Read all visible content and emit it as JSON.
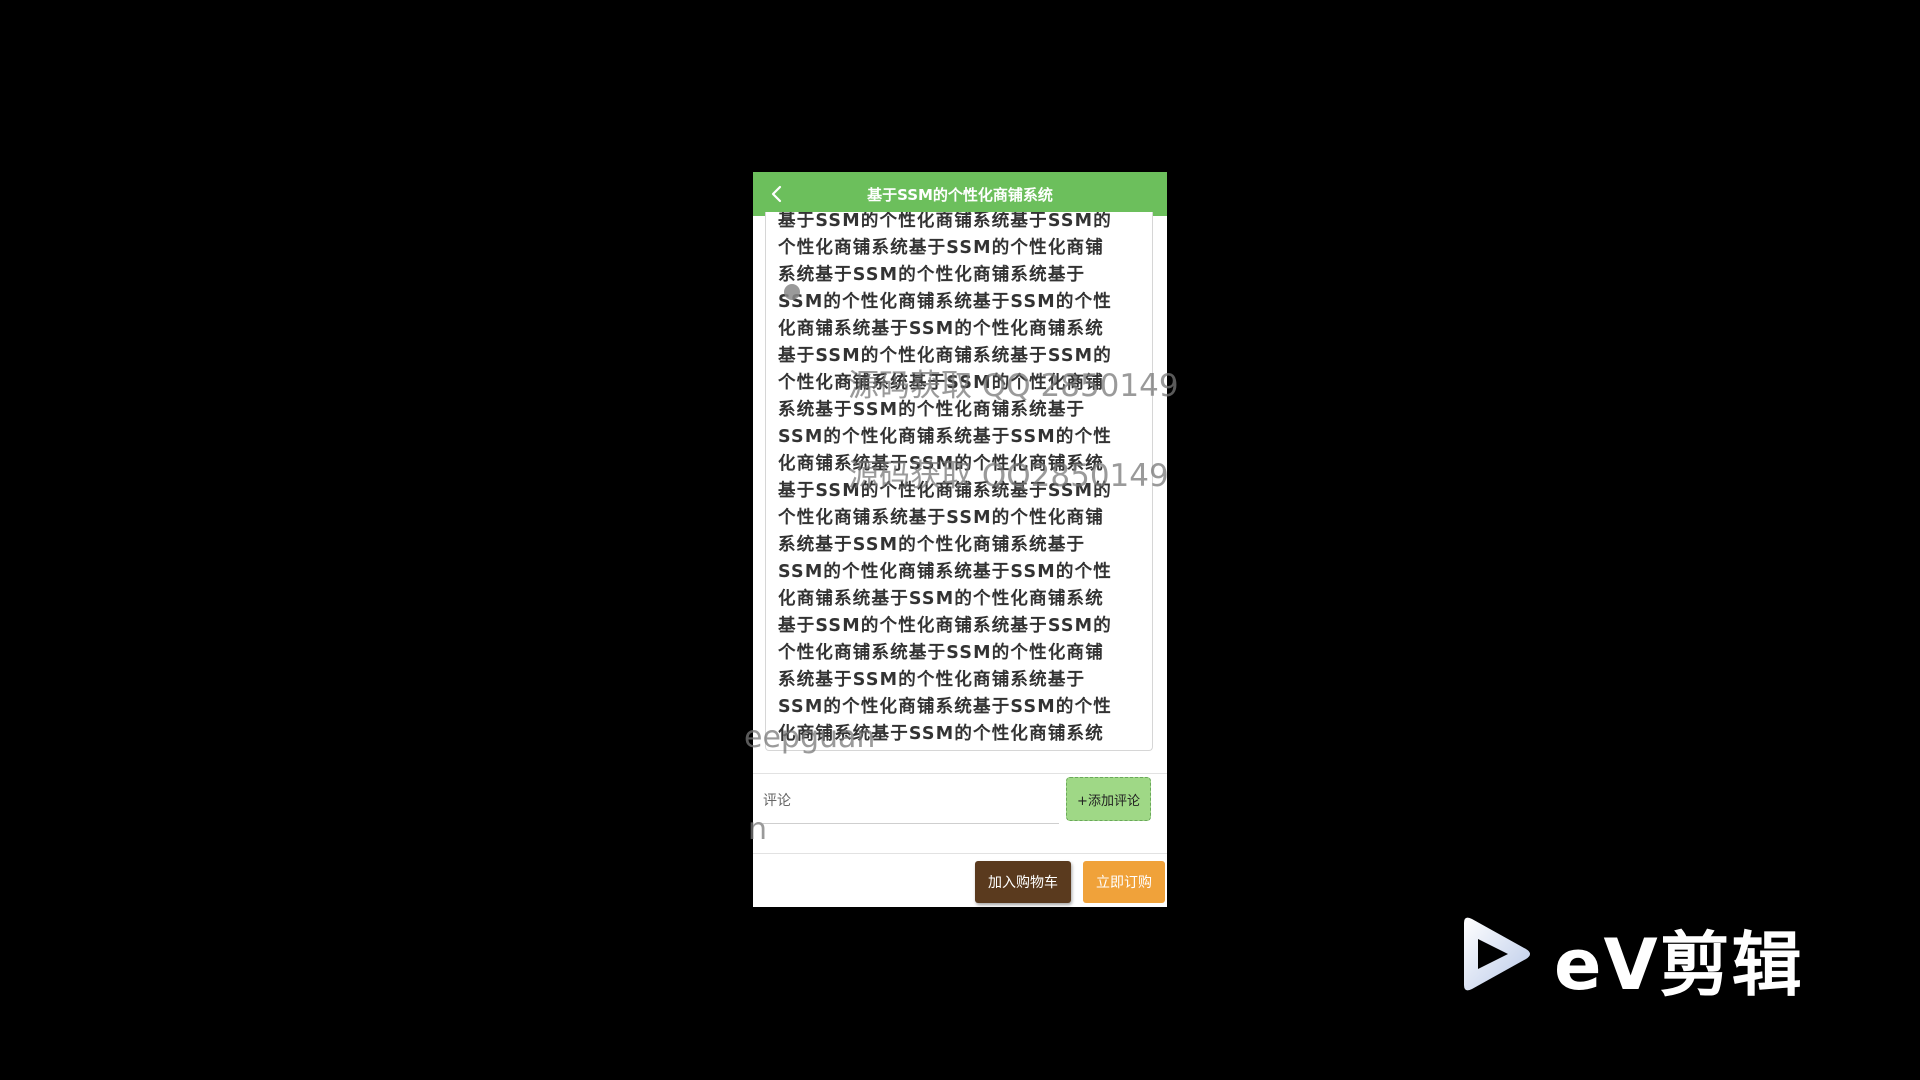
{
  "app": {
    "title": "基于SSM的个性化商铺系统",
    "back_icon": "chevron-left-icon"
  },
  "detail": {
    "text": "基于SSM的个性化商铺系统基于SSM的\n个性化商铺系统基于SSM的个性化商铺\n系统基于SSM的个性化商铺系统基于\nSSM的个性化商铺系统基于SSM的个性\n化商铺系统基于SSM的个性化商铺系统\n基于SSM的个性化商铺系统基于SSM的\n个性化商铺系统基于SSM的个性化商铺\n系统基于SSM的个性化商铺系统基于\nSSM的个性化商铺系统基于SSM的个性\n化商铺系统基于SSM的个性化商铺系统\n基于SSM的个性化商铺系统基于SSM的\n个性化商铺系统基于SSM的个性化商铺\n系统基于SSM的个性化商铺系统基于\nSSM的个性化商铺系统基于SSM的个性\n化商铺系统基于SSM的个性化商铺系统\n基于SSM的个性化商铺系统基于SSM的\n个性化商铺系统基于SSM的个性化商铺\n系统基于SSM的个性化商铺系统基于\nSSM的个性化商铺系统基于SSM的个性\n化商铺系统基于SSM的个性化商铺系统"
  },
  "comment": {
    "placeholder": "评论",
    "add_button": "+添加评论"
  },
  "actions": {
    "add_to_cart": "加入购物车",
    "buy_now": "立即订购"
  },
  "watermarks": {
    "line1": "源码获取 QQ 2850149",
    "line2": "源码获取 QQ2850149",
    "line3": "eepguan",
    "line4": "n"
  },
  "logo": {
    "text": "eV剪辑",
    "icon": "play-triangle-icon"
  },
  "colors": {
    "header_green": "#6cbf5c",
    "add_comment_green": "#9fd886",
    "cart_brown": "#5a3a1e",
    "buy_orange": "#f0a23a"
  }
}
